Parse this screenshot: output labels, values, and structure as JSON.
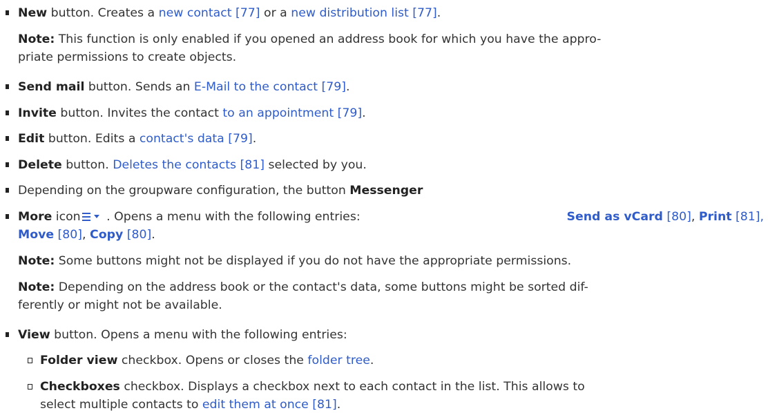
{
  "items": {
    "new": {
      "label": "New",
      "text1": " button. Creates a ",
      "link1": "new contact [77]",
      "text2": " or a ",
      "link2": "new distribution list [77]",
      "text3": ".",
      "note_label": "Note:",
      "note_line1": " This function is only enabled if you opened an address book for which you have the appro-",
      "note_line2": "priate permissions to create objects."
    },
    "send_mail": {
      "label": "Send mail",
      "text1": " button. Sends an ",
      "link1": "E-Mail to the contact [79]",
      "text2": "."
    },
    "invite": {
      "label": "Invite",
      "text1": " button. Invites the contact ",
      "link1": "to an appointment [79]",
      "text2": "."
    },
    "edit": {
      "label": "Edit",
      "text1": " button. Edits a ",
      "link1": "contact's data [79]",
      "text2": "."
    },
    "delete": {
      "label": "Delete",
      "text1": " button. ",
      "link1": "Deletes the contacts [81]",
      "text2": " selected by you."
    },
    "messenger": {
      "text1": "Depending on the groupware configuration, the button ",
      "label": "Messenger"
    },
    "more": {
      "label": "More",
      "text1": " icon",
      "text2": " . Opens a menu with the following entries: ",
      "entry1": "Send as vCard",
      "ref1": " [80]",
      "sep1": ", ",
      "entry2": "Print",
      "ref2": " [81],",
      "entry3": "Move",
      "ref3": " [80]",
      "sep3": ", ",
      "entry4": "Copy",
      "ref4": " [80]",
      "end": ".",
      "icon": "menu-caret-icon",
      "note1_label": "Note:",
      "note1_text": " Some buttons might not be displayed if you do not have the appropriate permissions.",
      "note2_label": "Note:",
      "note2_line1": " Depending on the address book or the contact's data, some buttons might be sorted dif-",
      "note2_line2": "ferently or might not be available."
    },
    "view": {
      "label": "View",
      "text1": " button. Opens a menu with the following entries:",
      "sub": [
        {
          "label": "Folder view",
          "text1": " checkbox. Opens or closes the ",
          "link1": "folder tree",
          "text2": "."
        },
        {
          "label": "Checkboxes",
          "line1": " checkbox. Displays a checkbox next to each contact in the list. This allows to",
          "line2_pre": "select multiple contacts to ",
          "link1": "edit them at once [81]",
          "line2_post": "."
        }
      ]
    }
  },
  "colors": {
    "link": "#2f5cc8",
    "text": "#333333",
    "bold": "#222222"
  }
}
